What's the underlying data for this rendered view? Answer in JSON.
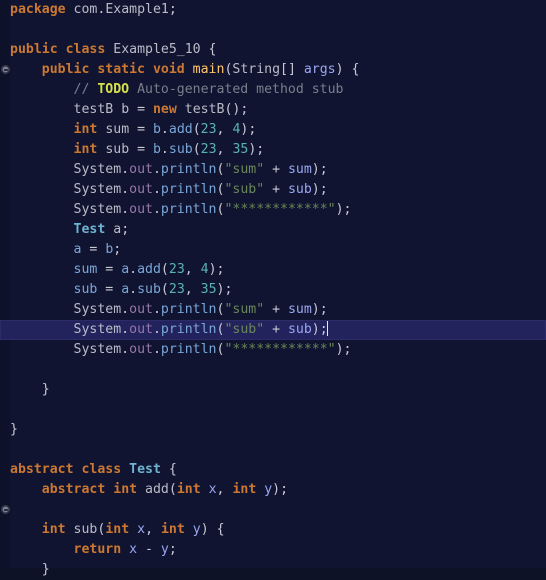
{
  "editor": {
    "language": "Java",
    "theme": "darcula",
    "background_color": "#101430",
    "current_line_color": "#22235c",
    "caret_color": "#e6e8f0",
    "colors": {
      "keyword": "#cc7832",
      "class_name": "#6fb3d2",
      "identifier": "#b9bcc7",
      "variable": "#9aa7f2",
      "method": "#7aa6d8",
      "method_declaration": "#ffc66d",
      "number": "#5ab3b3",
      "string": "#6a8759",
      "comment": "#787f8c",
      "todo": "#d6e04a",
      "gutter_marker": "#7c818f"
    }
  },
  "gutter": {
    "markers": [
      {
        "line_index": 3,
        "icon": "method-marker-icon",
        "tooltip": "Overriding method"
      },
      {
        "line_index": 25,
        "icon": "method-marker-icon",
        "tooltip": "Overriding method"
      }
    ]
  },
  "code": {
    "current_line_index": 16,
    "caret_line_index": 16,
    "lines": [
      {
        "tokens": [
          {
            "t": "package",
            "c": "kw"
          },
          {
            "t": " ",
            "c": "punc"
          },
          {
            "t": "com",
            "c": "ident"
          },
          {
            "t": ".",
            "c": "punc"
          },
          {
            "t": "Example1",
            "c": "ident"
          },
          {
            "t": ";",
            "c": "punc"
          }
        ]
      },
      {
        "tokens": []
      },
      {
        "tokens": [
          {
            "t": "public",
            "c": "kw"
          },
          {
            "t": " ",
            "c": "punc"
          },
          {
            "t": "class",
            "c": "kw"
          },
          {
            "t": " ",
            "c": "punc"
          },
          {
            "t": "Example5_10",
            "c": "type"
          },
          {
            "t": " {",
            "c": "punc"
          }
        ]
      },
      {
        "tokens": [
          {
            "t": "    ",
            "c": "punc"
          },
          {
            "t": "public",
            "c": "kw"
          },
          {
            "t": " ",
            "c": "punc"
          },
          {
            "t": "static",
            "c": "kw"
          },
          {
            "t": " ",
            "c": "punc"
          },
          {
            "t": "void",
            "c": "kw"
          },
          {
            "t": " ",
            "c": "punc"
          },
          {
            "t": "main",
            "c": "mname"
          },
          {
            "t": "(",
            "c": "punc"
          },
          {
            "t": "String",
            "c": "type"
          },
          {
            "t": "[] ",
            "c": "punc"
          },
          {
            "t": "args",
            "c": "var"
          },
          {
            "t": ") {",
            "c": "punc"
          }
        ]
      },
      {
        "tokens": [
          {
            "t": "        ",
            "c": "punc"
          },
          {
            "t": "// ",
            "c": "cmt"
          },
          {
            "t": "TODO",
            "c": "todo"
          },
          {
            "t": " Auto-generated method stub",
            "c": "cmt"
          }
        ]
      },
      {
        "tokens": [
          {
            "t": "        ",
            "c": "punc"
          },
          {
            "t": "testB",
            "c": "type"
          },
          {
            "t": " ",
            "c": "punc"
          },
          {
            "t": "b",
            "c": "ident"
          },
          {
            "t": " = ",
            "c": "punc"
          },
          {
            "t": "new",
            "c": "kw"
          },
          {
            "t": " ",
            "c": "punc"
          },
          {
            "t": "testB",
            "c": "ident"
          },
          {
            "t": "();",
            "c": "punc"
          }
        ]
      },
      {
        "tokens": [
          {
            "t": "        ",
            "c": "punc"
          },
          {
            "t": "int",
            "c": "kw"
          },
          {
            "t": " ",
            "c": "punc"
          },
          {
            "t": "sum",
            "c": "ident"
          },
          {
            "t": " = ",
            "c": "punc"
          },
          {
            "t": "b",
            "c": "meth"
          },
          {
            "t": ".",
            "c": "punc"
          },
          {
            "t": "add",
            "c": "meth"
          },
          {
            "t": "(",
            "c": "punc"
          },
          {
            "t": "23",
            "c": "num"
          },
          {
            "t": ", ",
            "c": "punc"
          },
          {
            "t": "4",
            "c": "num"
          },
          {
            "t": ");",
            "c": "punc"
          }
        ]
      },
      {
        "tokens": [
          {
            "t": "        ",
            "c": "punc"
          },
          {
            "t": "int",
            "c": "kw"
          },
          {
            "t": " ",
            "c": "punc"
          },
          {
            "t": "sub",
            "c": "ident"
          },
          {
            "t": " = ",
            "c": "punc"
          },
          {
            "t": "b",
            "c": "meth"
          },
          {
            "t": ".",
            "c": "punc"
          },
          {
            "t": "sub",
            "c": "meth"
          },
          {
            "t": "(",
            "c": "punc"
          },
          {
            "t": "23",
            "c": "num"
          },
          {
            "t": ", ",
            "c": "punc"
          },
          {
            "t": "35",
            "c": "num"
          },
          {
            "t": ");",
            "c": "punc"
          }
        ]
      },
      {
        "tokens": [
          {
            "t": "        ",
            "c": "punc"
          },
          {
            "t": "System",
            "c": "type"
          },
          {
            "t": ".",
            "c": "punc"
          },
          {
            "t": "out",
            "c": "fld"
          },
          {
            "t": ".",
            "c": "punc"
          },
          {
            "t": "println",
            "c": "meth"
          },
          {
            "t": "(",
            "c": "punc"
          },
          {
            "t": "\"sum\"",
            "c": "str"
          },
          {
            "t": " + ",
            "c": "punc"
          },
          {
            "t": "sum",
            "c": "var"
          },
          {
            "t": ");",
            "c": "punc"
          }
        ]
      },
      {
        "tokens": [
          {
            "t": "        ",
            "c": "punc"
          },
          {
            "t": "System",
            "c": "type"
          },
          {
            "t": ".",
            "c": "punc"
          },
          {
            "t": "out",
            "c": "fld"
          },
          {
            "t": ".",
            "c": "punc"
          },
          {
            "t": "println",
            "c": "meth"
          },
          {
            "t": "(",
            "c": "punc"
          },
          {
            "t": "\"sub\"",
            "c": "str"
          },
          {
            "t": " + ",
            "c": "punc"
          },
          {
            "t": "sub",
            "c": "var"
          },
          {
            "t": ");",
            "c": "punc"
          }
        ]
      },
      {
        "tokens": [
          {
            "t": "        ",
            "c": "punc"
          },
          {
            "t": "System",
            "c": "type"
          },
          {
            "t": ".",
            "c": "punc"
          },
          {
            "t": "out",
            "c": "fld"
          },
          {
            "t": ".",
            "c": "punc"
          },
          {
            "t": "println",
            "c": "meth"
          },
          {
            "t": "(",
            "c": "punc"
          },
          {
            "t": "\"************\"",
            "c": "str"
          },
          {
            "t": ");",
            "c": "punc"
          }
        ]
      },
      {
        "tokens": [
          {
            "t": "        ",
            "c": "punc"
          },
          {
            "t": "Test",
            "c": "cls"
          },
          {
            "t": " ",
            "c": "punc"
          },
          {
            "t": "a",
            "c": "ident"
          },
          {
            "t": ";",
            "c": "punc"
          }
        ]
      },
      {
        "tokens": [
          {
            "t": "        ",
            "c": "punc"
          },
          {
            "t": "a",
            "c": "meth"
          },
          {
            "t": " = ",
            "c": "punc"
          },
          {
            "t": "b",
            "c": "meth"
          },
          {
            "t": ";",
            "c": "punc"
          }
        ]
      },
      {
        "tokens": [
          {
            "t": "        ",
            "c": "punc"
          },
          {
            "t": "sum",
            "c": "meth"
          },
          {
            "t": " = ",
            "c": "punc"
          },
          {
            "t": "a",
            "c": "meth"
          },
          {
            "t": ".",
            "c": "punc"
          },
          {
            "t": "add",
            "c": "meth"
          },
          {
            "t": "(",
            "c": "punc"
          },
          {
            "t": "23",
            "c": "num"
          },
          {
            "t": ", ",
            "c": "punc"
          },
          {
            "t": "4",
            "c": "num"
          },
          {
            "t": ");",
            "c": "punc"
          }
        ]
      },
      {
        "tokens": [
          {
            "t": "        ",
            "c": "punc"
          },
          {
            "t": "sub",
            "c": "meth"
          },
          {
            "t": " = ",
            "c": "punc"
          },
          {
            "t": "a",
            "c": "meth"
          },
          {
            "t": ".",
            "c": "punc"
          },
          {
            "t": "sub",
            "c": "meth"
          },
          {
            "t": "(",
            "c": "punc"
          },
          {
            "t": "23",
            "c": "num"
          },
          {
            "t": ", ",
            "c": "punc"
          },
          {
            "t": "35",
            "c": "num"
          },
          {
            "t": ");",
            "c": "punc"
          }
        ]
      },
      {
        "tokens": [
          {
            "t": "        ",
            "c": "punc"
          },
          {
            "t": "System",
            "c": "type"
          },
          {
            "t": ".",
            "c": "punc"
          },
          {
            "t": "out",
            "c": "fld"
          },
          {
            "t": ".",
            "c": "punc"
          },
          {
            "t": "println",
            "c": "meth"
          },
          {
            "t": "(",
            "c": "punc"
          },
          {
            "t": "\"sum\"",
            "c": "str"
          },
          {
            "t": " + ",
            "c": "punc"
          },
          {
            "t": "sum",
            "c": "var"
          },
          {
            "t": ");",
            "c": "punc"
          }
        ]
      },
      {
        "caret_after": true,
        "tokens": [
          {
            "t": "        ",
            "c": "punc"
          },
          {
            "t": "System",
            "c": "type"
          },
          {
            "t": ".",
            "c": "punc"
          },
          {
            "t": "out",
            "c": "fld"
          },
          {
            "t": ".",
            "c": "punc"
          },
          {
            "t": "println",
            "c": "meth"
          },
          {
            "t": "(",
            "c": "punc"
          },
          {
            "t": "\"sub\"",
            "c": "str"
          },
          {
            "t": " + ",
            "c": "punc"
          },
          {
            "t": "sub",
            "c": "var"
          },
          {
            "t": ");",
            "c": "punc"
          }
        ]
      },
      {
        "tokens": [
          {
            "t": "        ",
            "c": "punc"
          },
          {
            "t": "System",
            "c": "type"
          },
          {
            "t": ".",
            "c": "punc"
          },
          {
            "t": "out",
            "c": "fld"
          },
          {
            "t": ".",
            "c": "punc"
          },
          {
            "t": "println",
            "c": "meth"
          },
          {
            "t": "(",
            "c": "punc"
          },
          {
            "t": "\"************\"",
            "c": "str"
          },
          {
            "t": ");",
            "c": "punc"
          }
        ]
      },
      {
        "tokens": []
      },
      {
        "tokens": [
          {
            "t": "    }",
            "c": "punc"
          }
        ]
      },
      {
        "tokens": []
      },
      {
        "tokens": [
          {
            "t": "}",
            "c": "punc"
          }
        ]
      },
      {
        "tokens": []
      },
      {
        "tokens": [
          {
            "t": "abstract",
            "c": "kw"
          },
          {
            "t": " ",
            "c": "punc"
          },
          {
            "t": "class",
            "c": "kw"
          },
          {
            "t": " ",
            "c": "punc"
          },
          {
            "t": "Test",
            "c": "cls"
          },
          {
            "t": " {",
            "c": "punc"
          }
        ]
      },
      {
        "tokens": [
          {
            "t": "    ",
            "c": "punc"
          },
          {
            "t": "abstract",
            "c": "kw"
          },
          {
            "t": " ",
            "c": "punc"
          },
          {
            "t": "int",
            "c": "kw"
          },
          {
            "t": " ",
            "c": "punc"
          },
          {
            "t": "add",
            "c": "type"
          },
          {
            "t": "(",
            "c": "punc"
          },
          {
            "t": "int",
            "c": "kw"
          },
          {
            "t": " ",
            "c": "punc"
          },
          {
            "t": "x",
            "c": "var"
          },
          {
            "t": ", ",
            "c": "punc"
          },
          {
            "t": "int",
            "c": "kw"
          },
          {
            "t": " ",
            "c": "punc"
          },
          {
            "t": "y",
            "c": "var"
          },
          {
            "t": ");",
            "c": "punc"
          }
        ]
      },
      {
        "tokens": []
      },
      {
        "tokens": [
          {
            "t": "    ",
            "c": "punc"
          },
          {
            "t": "int",
            "c": "kw"
          },
          {
            "t": " ",
            "c": "punc"
          },
          {
            "t": "sub",
            "c": "type"
          },
          {
            "t": "(",
            "c": "punc"
          },
          {
            "t": "int",
            "c": "kw"
          },
          {
            "t": " ",
            "c": "punc"
          },
          {
            "t": "x",
            "c": "var"
          },
          {
            "t": ", ",
            "c": "punc"
          },
          {
            "t": "int",
            "c": "kw"
          },
          {
            "t": " ",
            "c": "punc"
          },
          {
            "t": "y",
            "c": "var"
          },
          {
            "t": ") {",
            "c": "punc"
          }
        ]
      },
      {
        "tokens": [
          {
            "t": "        ",
            "c": "punc"
          },
          {
            "t": "return",
            "c": "kw"
          },
          {
            "t": " ",
            "c": "punc"
          },
          {
            "t": "x",
            "c": "var"
          },
          {
            "t": " - ",
            "c": "punc"
          },
          {
            "t": "y",
            "c": "var"
          },
          {
            "t": ";",
            "c": "punc"
          }
        ]
      },
      {
        "tokens": [
          {
            "t": "    }",
            "c": "punc"
          }
        ]
      }
    ]
  }
}
